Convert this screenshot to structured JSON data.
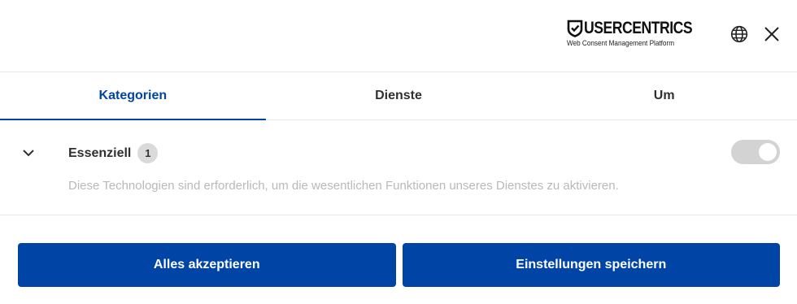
{
  "header": {
    "brand_name": "USERCENTRICS",
    "brand_tagline": "Web Consent Management Platform",
    "icons": {
      "logo": "shield-check-icon",
      "language": "globe-icon",
      "close": "close-icon"
    }
  },
  "tabs": [
    {
      "label": "Kategorien",
      "active": true
    },
    {
      "label": "Dienste",
      "active": false
    },
    {
      "label": "Um",
      "active": false
    }
  ],
  "category": {
    "title": "Essenziell",
    "count": "1",
    "description": "Diese Technologien sind erforderlich, um die wesentlichen Funktionen unseres Dienstes zu aktivieren.",
    "toggle_on": true,
    "toggle_disabled": true,
    "expand_icon": "chevron-down-icon"
  },
  "actions": {
    "accept_all": "Alles akzeptieren",
    "save_settings": "Einstellungen speichern"
  },
  "colors": {
    "accent": "#0045a5",
    "toggle_disabled": "#d3d3d3",
    "description_text": "#b9b9b9"
  }
}
